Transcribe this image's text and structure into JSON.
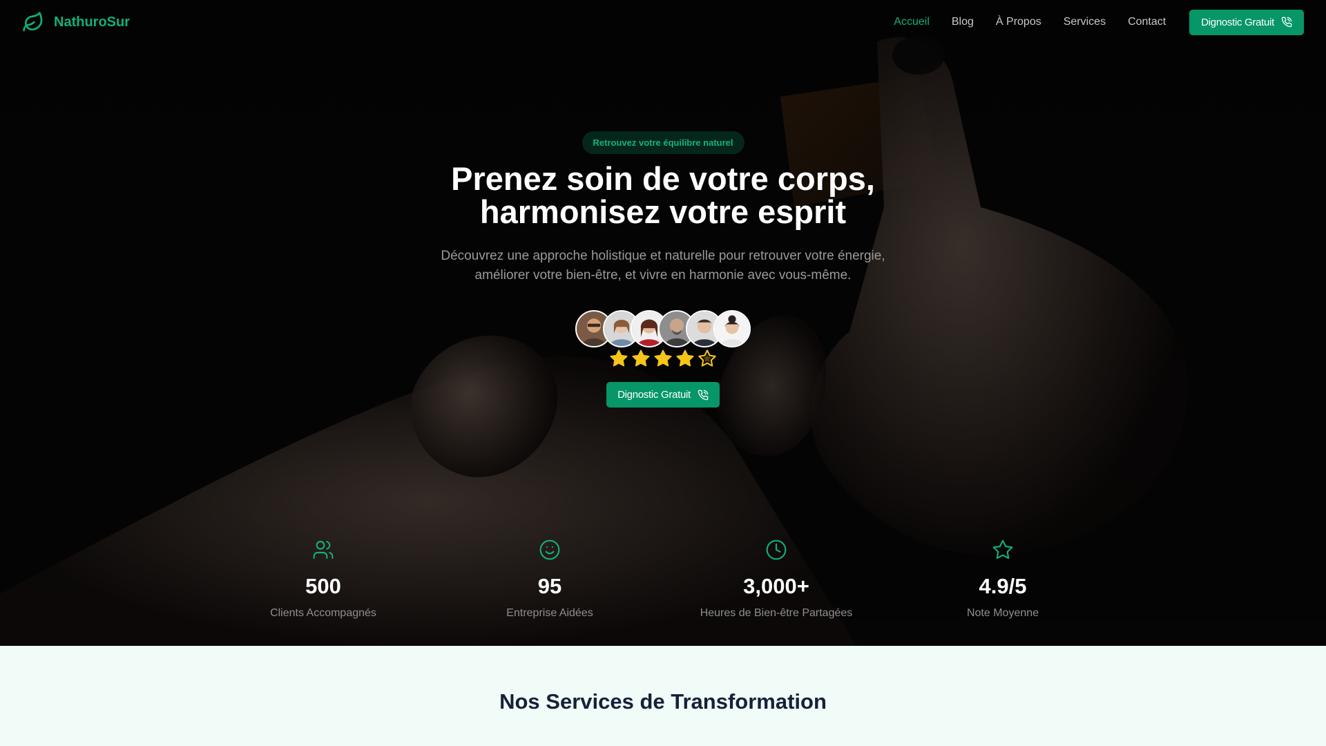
{
  "nav": {
    "brand": "NathuroSur",
    "links": [
      "Accueil",
      "Blog",
      "À Propos",
      "Services",
      "Contact"
    ],
    "cta": "Dignostic Gratuit"
  },
  "hero": {
    "eyebrow": "Retrouvez votre équilibre naturel",
    "title_line1": "Prenez soin de votre corps,",
    "title_line2": "harmonisez votre esprit",
    "subtitle": "Découvrez une approche holistique et naturelle pour retrouver votre énergie, améliorer votre bien-être, et vivre en harmonie avec vous-même.",
    "rating": 4.5,
    "cta": "Dignostic Gratuit"
  },
  "stats": [
    {
      "icon": "users-icon",
      "value": "500",
      "label": "Clients Accompagnés"
    },
    {
      "icon": "smile-icon",
      "value": "95",
      "label": "Entreprise Aidées"
    },
    {
      "icon": "clock-icon",
      "value": "3,000+",
      "label": "Heures de Bien-être Partagées"
    },
    {
      "icon": "star-icon",
      "value": "4.9/5",
      "label": "Note Moyenne"
    }
  ],
  "services": {
    "title": "Nos Services de Transformation"
  },
  "colors": {
    "accent": "#079667",
    "accent_text": "#12b07a",
    "star": "#f5c518",
    "services_bg": "#f1fbf7",
    "heading_dark": "#14213a"
  }
}
